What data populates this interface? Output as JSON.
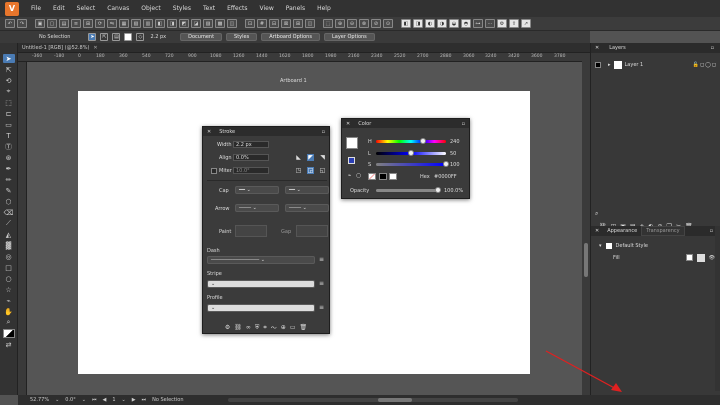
{
  "menu": [
    "File",
    "Edit",
    "Select",
    "Canvas",
    "Object",
    "Styles",
    "Text",
    "Effects",
    "View",
    "Panels",
    "Help"
  ],
  "logo": "V",
  "context": {
    "selection": "No Selection",
    "stroke_value": "2.2 px",
    "buttons": [
      "Document",
      "Styles",
      "Artboard Options",
      "Layer Options"
    ]
  },
  "document": {
    "tab": "Untitled-1 [RGB] (@52.8%)"
  },
  "ruler": [
    "-360",
    "-180",
    "0",
    "180",
    "360",
    "540",
    "720",
    "900",
    "1080",
    "1260",
    "1440",
    "1620",
    "1800",
    "1980",
    "2160",
    "2340",
    "2520",
    "2700",
    "2880",
    "3060",
    "3240",
    "3420",
    "3600",
    "3780",
    "3960"
  ],
  "artboard_label": "Artboard 1",
  "stroke_panel": {
    "title": "Stroke",
    "width_label": "Width",
    "width_value": "2.2 px",
    "align_label": "Align",
    "align_value": "0.0%",
    "miter_label": "Miter",
    "miter_value": "10.0°",
    "cap_label": "Cap",
    "arrow_label": "Arrow",
    "paint_label": "Paint",
    "gap_label": "Gap",
    "dash_label": "Dash",
    "stripe_label": "Stripe",
    "profile_label": "Profile"
  },
  "color_panel": {
    "title": "Color",
    "h_label": "H",
    "h_value": "240",
    "l_label": "L",
    "l_value": "50",
    "s_label": "S",
    "s_value": "100",
    "hex_label": "Hex",
    "hex_value": "#0000FF",
    "opacity_label": "Opacity",
    "opacity_value": "100.0%",
    "h_fraction": 0.67,
    "l_fraction": 0.5,
    "s_fraction": 1.0
  },
  "layers_panel": {
    "title": "Layers",
    "layer": "Layer 1"
  },
  "appearance_panel": {
    "tab1": "Appearance",
    "tab2": "Transparency",
    "style": "Default Style",
    "fill": "Fill"
  },
  "status": {
    "zoom": "52.77%",
    "angle": "0.0°",
    "page": "1",
    "selection": "No Selection"
  },
  "colors": {
    "accent": "#4a7bb4",
    "swatch": "#2b3fb5",
    "arrow": "#e02020",
    "logo": "#e8762c"
  }
}
